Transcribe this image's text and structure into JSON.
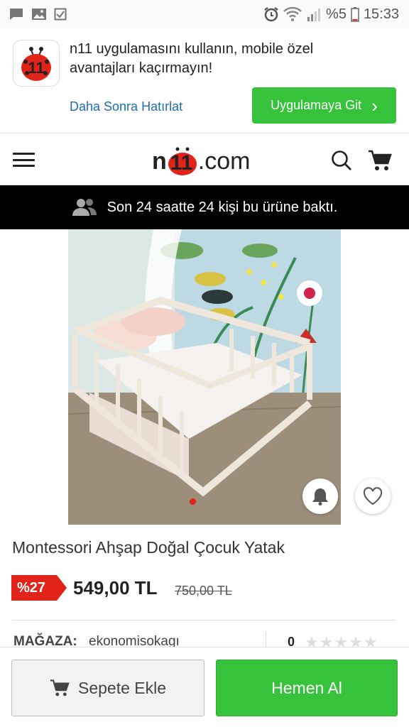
{
  "status_bar": {
    "battery": "%5",
    "time": "15:33",
    "icons": [
      "chat-icon",
      "image-icon",
      "checkbox-icon",
      "alarm-icon",
      "wifi-icon",
      "signal-icon",
      "battery-icon"
    ]
  },
  "app_banner": {
    "text": "n11 uygulamasını kullanın, mobile özel avantajları kaçırmayın!",
    "remind_later": "Daha Sonra Hatırlat",
    "go_app_label": "Uygulamaya Git"
  },
  "header": {
    "logo_n": "n",
    "logo_11": "11",
    "logo_com": ".com"
  },
  "notice": {
    "text": "Son 24 saatte 24 kişi bu ürüne baktı."
  },
  "gallery": {
    "image_count_shown": 1,
    "active_index": 0
  },
  "product": {
    "title": "Montessori Ahşap Doğal Çocuk Yatak",
    "discount": "%27",
    "price": "549,00 TL",
    "old_price": "750,00 TL"
  },
  "store": {
    "label": "MAĞAZA:",
    "name": "ekonomisokagı",
    "rating_count": "0",
    "stars": "★★★★★"
  },
  "actions": {
    "add_to_cart": "Sepete Ekle",
    "buy_now": "Hemen Al"
  },
  "colors": {
    "brand_green": "#36c33b",
    "brand_red": "#e2231a",
    "link_blue": "#1f6db3"
  }
}
